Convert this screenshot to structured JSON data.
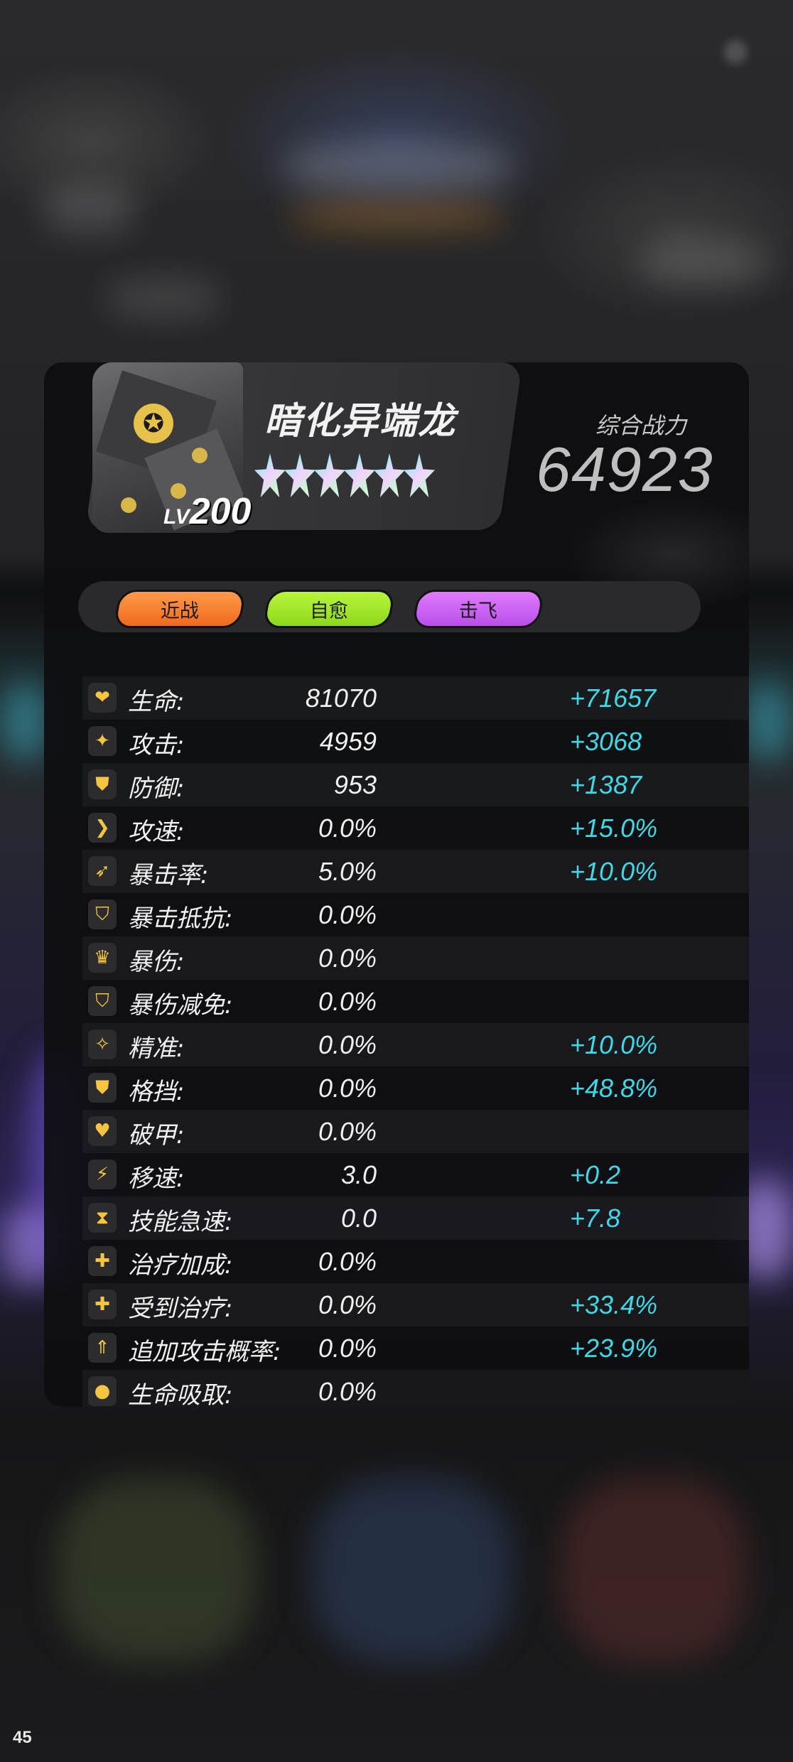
{
  "hero": {
    "name": "暗化异端龙",
    "level_label": "LV",
    "level": "200",
    "stars": 6,
    "portrait_icon": "star-emblem-icon"
  },
  "power": {
    "label": "综合战力",
    "value": "64923"
  },
  "tags": [
    {
      "label": "近战",
      "color": "#f57a2a"
    },
    {
      "label": "自愈",
      "color": "#9fe324"
    },
    {
      "label": "击飞",
      "color": "#cc60f2"
    }
  ],
  "stats": [
    {
      "icon": "heart-icon",
      "glyph": "❤",
      "label": "生命:",
      "base": "81070",
      "bonus": "+71657"
    },
    {
      "icon": "attack-sparkle-icon",
      "glyph": "✦",
      "label": "攻击:",
      "base": "4959",
      "bonus": "+3068"
    },
    {
      "icon": "shield-icon",
      "glyph": "⛊",
      "label": "防御:",
      "base": "953",
      "bonus": "+1387"
    },
    {
      "icon": "chevron-right-icon",
      "glyph": "❯",
      "label": "攻速:",
      "base": "0.0%",
      "bonus": "+15.0%"
    },
    {
      "icon": "feather-icon",
      "glyph": "➶",
      "label": "暴击率:",
      "base": "5.0%",
      "bonus": "+10.0%"
    },
    {
      "icon": "crit-resist-shield-icon",
      "glyph": "⛉",
      "label": "暴击抵抗:",
      "base": "0.0%",
      "bonus": ""
    },
    {
      "icon": "crown-icon",
      "glyph": "♛",
      "label": "暴伤:",
      "base": "0.0%",
      "bonus": ""
    },
    {
      "icon": "crit-damage-reduction-icon",
      "glyph": "⛉",
      "label": "暴伤减免:",
      "base": "0.0%",
      "bonus": ""
    },
    {
      "icon": "crosshair-sparkle-icon",
      "glyph": "✧",
      "label": "精准:",
      "base": "0.0%",
      "bonus": "+10.0%"
    },
    {
      "icon": "block-shield-icon",
      "glyph": "⛊",
      "label": "格挡:",
      "base": "0.0%",
      "bonus": "+48.8%"
    },
    {
      "icon": "armor-break-icon",
      "glyph": "♥",
      "label": "破甲:",
      "base": "0.0%",
      "bonus": ""
    },
    {
      "icon": "lightning-icon",
      "glyph": "⚡",
      "label": "移速:",
      "base": "3.0",
      "bonus": "+0.2"
    },
    {
      "icon": "hourglass-icon",
      "glyph": "⧗",
      "label": "技能急速:",
      "base": "0.0",
      "bonus": "+7.8"
    },
    {
      "icon": "heal-plus-icon",
      "glyph": "✚",
      "label": "治疗加成:",
      "base": "0.0%",
      "bonus": ""
    },
    {
      "icon": "receive-heal-icon",
      "glyph": "✚",
      "label": "受到治疗:",
      "base": "0.0%",
      "bonus": "+33.4%"
    },
    {
      "icon": "double-chevron-up-icon",
      "glyph": "⇑",
      "label": "追加攻击概率:",
      "base": "0.0%",
      "bonus": "+23.9%"
    },
    {
      "icon": "blood-drop-icon",
      "glyph": "●",
      "label": "生命吸取:",
      "base": "0.0%",
      "bonus": ""
    }
  ],
  "page_number": "45",
  "colors": {
    "bonus": "#3fd8e6",
    "icon_accent": "#f5c542",
    "panel_bg": "#0e0e10"
  }
}
